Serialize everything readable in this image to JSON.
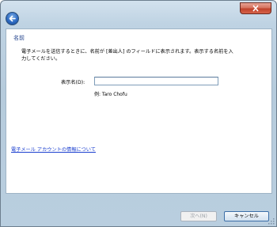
{
  "window": {
    "heading": "名前",
    "description": "電子メールを送信するときに、名前が [差出人] のフィールドに表示されます。表示する名前を入力してください。",
    "field_label": "表示名(D):",
    "field_value": "",
    "example": "例: Taro Chofu",
    "link": "電子メール アカウントの情報について"
  },
  "footer": {
    "next_label": "次へ(N)",
    "cancel_label": "キャンセル"
  }
}
